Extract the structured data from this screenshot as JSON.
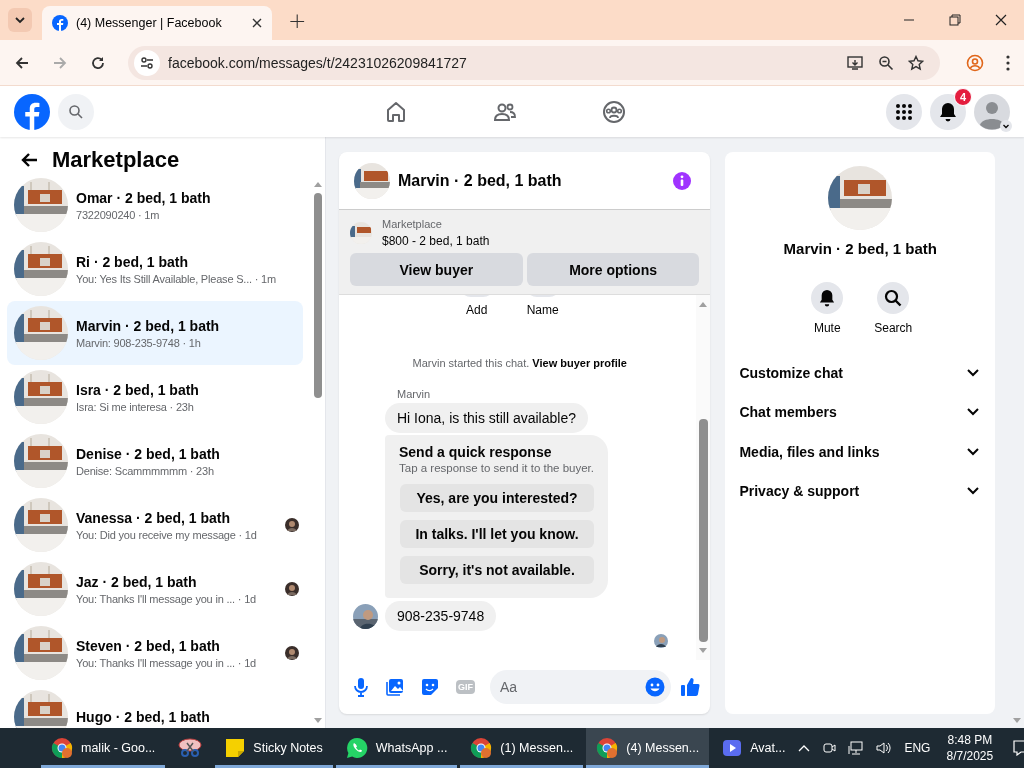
{
  "browser": {
    "tab_title": "(4) Messenger | Facebook",
    "new_tab": "+",
    "url": "facebook.com/messages/t/24231026209841727"
  },
  "topbar": {
    "notification_count": "4"
  },
  "sidebar": {
    "title": "Marketplace",
    "conversations": [
      {
        "name": "Omar · 2 bed, 1 bath",
        "preview": "7322090240 · 1m",
        "selected": false,
        "read_receipt": false
      },
      {
        "name": "Ri · 2 bed, 1 bath",
        "preview": "You: Yes Its Still Available, Please S...  · 1m",
        "selected": false,
        "read_receipt": false
      },
      {
        "name": "Marvin · 2 bed, 1 bath",
        "preview": "Marvin: 908-235-9748 · 1h",
        "selected": true,
        "read_receipt": false
      },
      {
        "name": "Isra · 2 bed, 1 bath",
        "preview": "Isra: Si me interesa · 23h",
        "selected": false,
        "read_receipt": false
      },
      {
        "name": "Denise · 2 bed, 1 bath",
        "preview": "Denise: Scammmmmm · 23h",
        "selected": false,
        "read_receipt": false
      },
      {
        "name": "Vanessa · 2 bed, 1 bath",
        "preview": "You: Did you receive my message · 1d",
        "selected": false,
        "read_receipt": true
      },
      {
        "name": "Jaz · 2 bed, 1 bath",
        "preview": "You: Thanks I'll message you in ...  · 1d",
        "selected": false,
        "read_receipt": true
      },
      {
        "name": "Steven · 2 bed, 1 bath",
        "preview": "You: Thanks I'll message you in ...  · 1d",
        "selected": false,
        "read_receipt": true
      },
      {
        "name": "Hugo · 2 bed, 1 bath",
        "selected": false,
        "read_receipt": false
      }
    ]
  },
  "chat": {
    "title": "Marvin · 2 bed, 1 bath",
    "listing": {
      "label": "Marketplace",
      "price": "$800 - 2 bed, 1 bath"
    },
    "buttons": [
      "View buyer",
      "More options"
    ],
    "partial_actions": [
      "Add",
      "Name"
    ],
    "system_text": "Marvin started this chat.",
    "system_link": "View buyer profile",
    "sender": "Marvin",
    "first_message": "Hi Iona, is this still available?",
    "quick_response": {
      "title": "Send a quick response",
      "subtitle": "Tap a response to send it to the buyer.",
      "options": [
        "Yes, are you interested?",
        "In talks. I'll let you know.",
        "Sorry, it's not available."
      ]
    },
    "last_message": "908-235-9748",
    "composer": {
      "gif": "GIF",
      "placeholder": "Aa"
    }
  },
  "details": {
    "name": "Marvin · 2 bed, 1 bath",
    "actions": [
      "Mute",
      "Search"
    ],
    "sections": [
      {
        "label": "Customize chat",
        "expanded": false
      },
      {
        "label": "Chat members",
        "expanded": false
      },
      {
        "label": "Media, files and links",
        "expanded": false
      },
      {
        "label": "Privacy & support",
        "expanded": false
      }
    ]
  },
  "taskbar": {
    "apps": [
      {
        "kind": "chrome",
        "label": "malik - Goo...",
        "selected": false,
        "running": true
      },
      {
        "kind": "snip",
        "selected": false,
        "running": false
      },
      {
        "kind": "notes",
        "label": "Sticky Notes",
        "selected": false,
        "running": true
      },
      {
        "kind": "whatsapp",
        "label": "WhatsApp ...",
        "selected": false,
        "running": true
      },
      {
        "kind": "chrome",
        "label": "(1) Messen...",
        "selected": false,
        "running": true
      },
      {
        "kind": "chrome",
        "label": "(4) Messen...",
        "selected": true,
        "running": true
      },
      {
        "kind": "video",
        "label": "Avat...",
        "selected": false,
        "running": false
      }
    ],
    "language": "ENG",
    "time": "8:48 PM",
    "date": "8/7/2025"
  }
}
